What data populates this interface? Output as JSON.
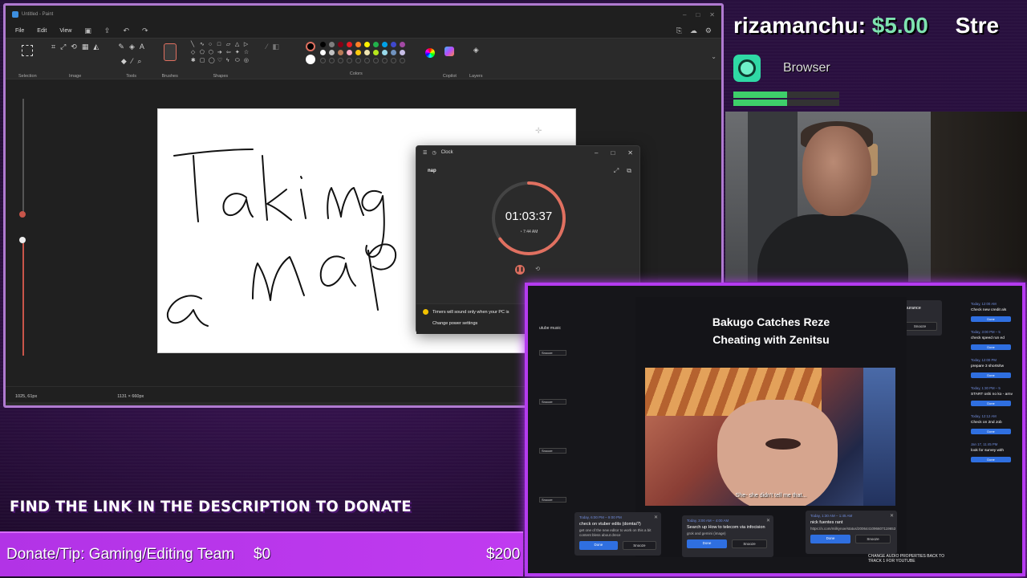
{
  "paint": {
    "title": "Untitled - Paint",
    "menu": [
      "File",
      "Edit",
      "View"
    ],
    "ribbon_labels": [
      "Selection",
      "Image",
      "Tools",
      "Brushes",
      "Shapes",
      "Colors",
      "Copilot",
      "Layers"
    ],
    "status_position": "1025, 61px",
    "status_canvas_size": "1131 × 660px",
    "canvas_text_line1": "Taking",
    "canvas_text_line2": "a nap",
    "palette": [
      "#000000",
      "#7f7f7f",
      "#880015",
      "#ed1c24",
      "#ff7f27",
      "#fff200",
      "#22b14c",
      "#00a2e8",
      "#3f48cc",
      "#a349a4",
      "#ffffff",
      "#c3c3c3",
      "#b97a57",
      "#ffaec9",
      "#ffc90e",
      "#efe4b0",
      "#b5e61d",
      "#99d9ea",
      "#7092be",
      "#c8bfe7"
    ]
  },
  "clock": {
    "title": "Clock",
    "timer_name": "nap",
    "time_remaining": "01:03:37",
    "alarm_time": "7:44 AM",
    "progress_fraction": 0.65,
    "notice": "Timers will sound only when your PC is",
    "notice_link": "Change power settings"
  },
  "donation": {
    "name": "rizamanchu:",
    "amount": "$5.00",
    "tail": "Stre"
  },
  "browser_source": {
    "label": "Browser",
    "meter_levels": [
      0.51,
      0.51
    ]
  },
  "video": {
    "title_line1": "Bakugo Catches Reze",
    "title_line2": "Cheating with Zenitsu",
    "subtitle": "She- she didn't tell me that..."
  },
  "tasks": {
    "top_card": {
      "title": "Check ADP for health insurance",
      "done": "Done",
      "snooze": "Snooze"
    },
    "left_items": [
      "utube music",
      "Snooze"
    ],
    "bottom_cards": [
      {
        "meta": "Today, 6:00 PM – 9:00 PM",
        "title": "check on vtuber edits (domtai?)",
        "desc": "get one of the new editor to work on this a bit content bless about drece",
        "done": "Done",
        "snooze": "Snooze"
      },
      {
        "meta": "Today, 3:00 AM – 4:00 AM",
        "title": "Search up How to telecom via infocision",
        "desc": "grok and gemini (image)",
        "done": "Done",
        "snooze": "Snooze"
      },
      {
        "meta": "Today, 1:30 AM – 1:45 AM",
        "title": "nick fuentes rant",
        "desc": "https://x.com/milkynoe/status/2006441096607119653",
        "done": "Done",
        "snooze": "Snooze"
      }
    ],
    "right_items": [
      {
        "meta": "Today, 12:00 AM",
        "title": "Check new credit als",
        "done": "Done"
      },
      {
        "meta": "Today, 3:00 PM – 5",
        "title": "check speed run ed",
        "done": "Done"
      },
      {
        "meta": "Today, 12:00 PM",
        "title": "prepare 3 shorts/tw",
        "done": "Done"
      },
      {
        "meta": "Today, 1:30 PM – 5",
        "title": "START oshi no ko - arnv",
        "done": "Done"
      },
      {
        "meta": "Today, 12:12 AM",
        "title": "Check on 2nd Job",
        "done": "Done"
      },
      {
        "meta": "Jan 17, 11:45 PM",
        "title": "look for survey with",
        "done": "Done"
      }
    ],
    "bottom_right_text": "CHANGE AUDIO PROPERTIES BACK TO TRACK 1 FOR YOUTUBE"
  },
  "footer": {
    "find_link": "FIND THE LINK IN THE DESCRIPTION TO DONATE",
    "goal_label": "Donate/Tip: Gaming/Editing Team",
    "goal_current": "$0",
    "goal_target": "$200"
  },
  "colors": {
    "accent_purple": "#b53bf0",
    "donation_green": "#7ee3b0",
    "timer_ring": "#e07060"
  }
}
